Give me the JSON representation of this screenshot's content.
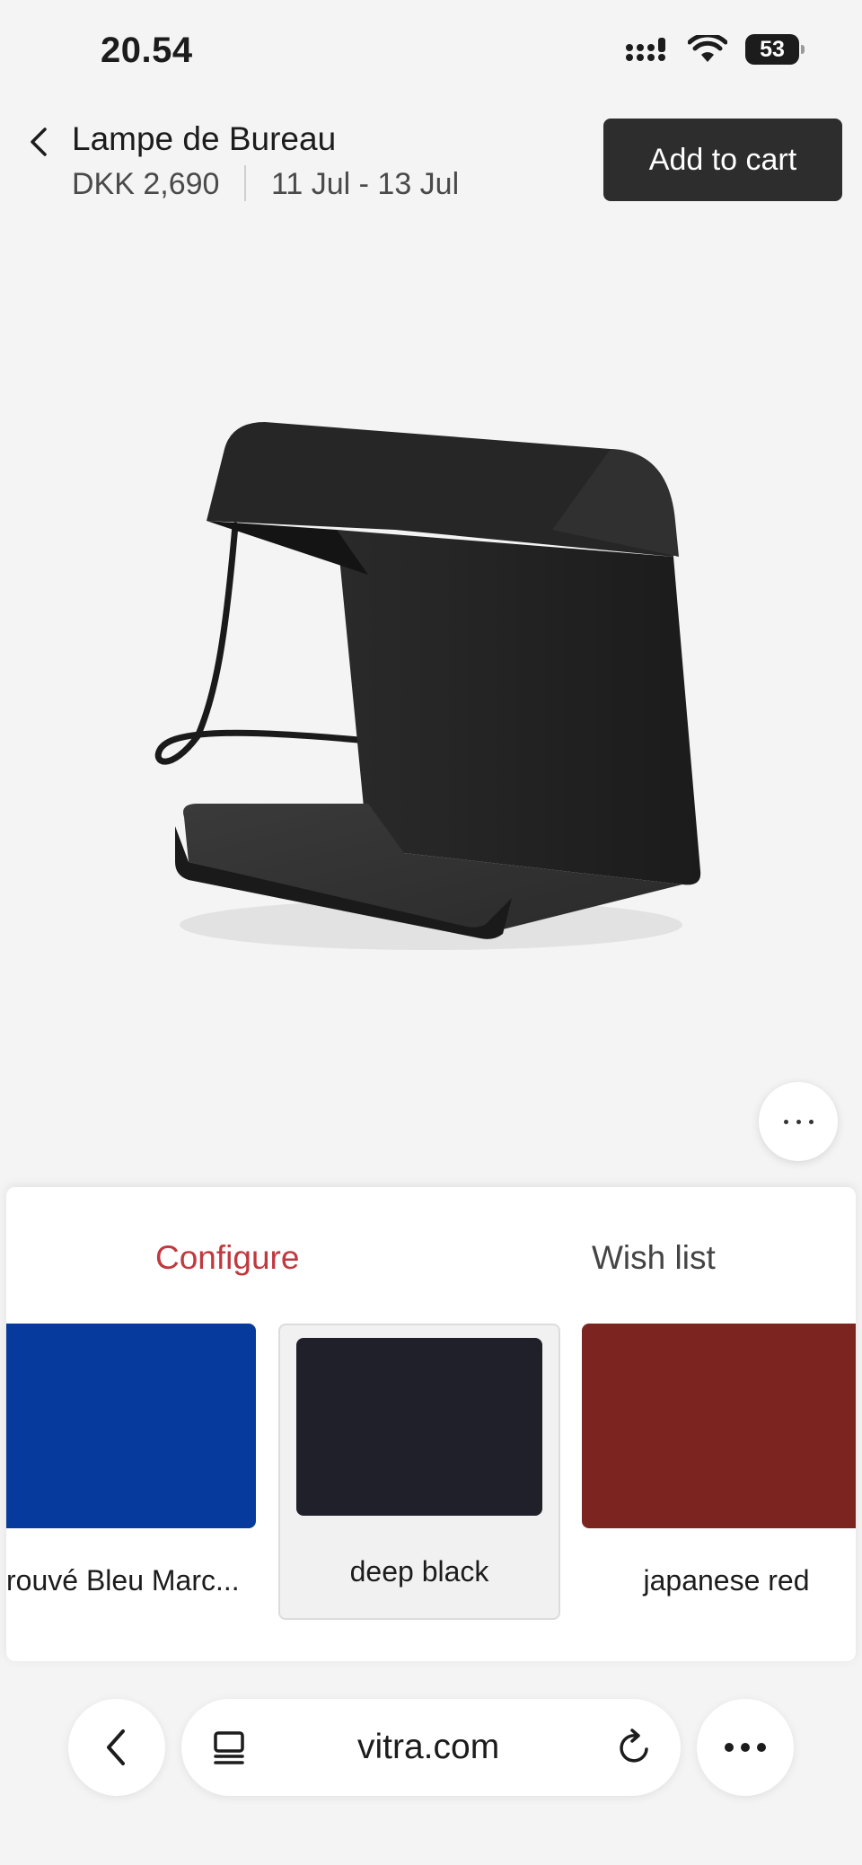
{
  "status_bar": {
    "time": "20.54",
    "battery": "53"
  },
  "product": {
    "title": "Lampe de Bureau",
    "price": "DKK 2,690",
    "delivery": "11 Jul - 13 Jul",
    "add_to_cart_label": "Add to cart"
  },
  "sheet": {
    "tabs": [
      {
        "label": "Configure",
        "active": true
      },
      {
        "label": "Wish list",
        "active": false
      }
    ],
    "swatches": [
      {
        "label": "rouvé Bleu Marc...",
        "color": "#063a9c",
        "selected": false
      },
      {
        "label": "deep black",
        "color": "#1f2029",
        "selected": true
      },
      {
        "label": "japanese red",
        "color": "#7c2520",
        "selected": false
      }
    ]
  },
  "browser": {
    "url": "vitra.com"
  },
  "colors": {
    "accent": "#c0393f",
    "button_dark": "#2d2d2d"
  }
}
